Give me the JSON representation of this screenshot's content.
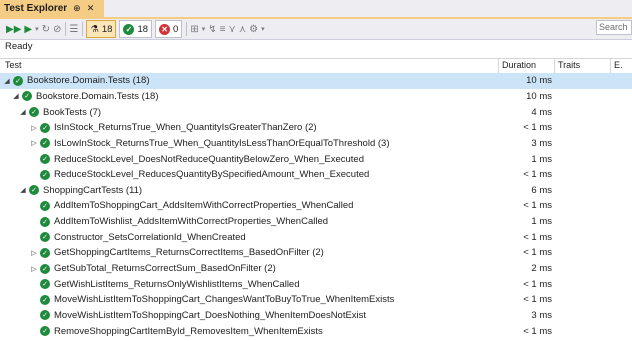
{
  "window": {
    "tab_title": "Test Explorer",
    "pin_glyph": "⊕",
    "close_glyph": "✕"
  },
  "toolbar": {
    "total_count": "18",
    "passed_count": "18",
    "failed_count": "0",
    "search_placeholder": "Search"
  },
  "status": {
    "text": "Ready"
  },
  "columns": {
    "test": "Test",
    "duration": "Duration",
    "traits": "Traits",
    "error": "E."
  },
  "colors": {
    "accent": "#f5cc84",
    "pass": "#1e8a3c",
    "fail": "#d13438",
    "selected_row": "#cce4f7"
  },
  "tree": [
    {
      "indent": 0,
      "expand": "expanded",
      "name": "Bookstore.Domain.Tests (18)",
      "duration": "10 ms",
      "selected": true
    },
    {
      "indent": 1,
      "expand": "expanded",
      "name": "Bookstore.Domain.Tests (18)",
      "duration": "10 ms"
    },
    {
      "indent": 2,
      "expand": "expanded",
      "name": "BookTests (7)",
      "duration": "4 ms"
    },
    {
      "indent": 3,
      "expand": "collapsed",
      "name": "IsInStock_ReturnsTrue_When_QuantityIsGreaterThanZero (2)",
      "duration": "< 1 ms"
    },
    {
      "indent": 3,
      "expand": "collapsed",
      "name": "IsLowInStock_ReturnsTrue_When_QuantityIsLessThanOrEqualToThreshold (3)",
      "duration": "3 ms"
    },
    {
      "indent": 3,
      "expand": "none",
      "name": "ReduceStockLevel_DoesNotReduceQuantityBelowZero_When_Executed",
      "duration": "1 ms"
    },
    {
      "indent": 3,
      "expand": "none",
      "name": "ReduceStockLevel_ReducesQuantityBySpecifiedAmount_When_Executed",
      "duration": "< 1 ms"
    },
    {
      "indent": 2,
      "expand": "expanded",
      "name": "ShoppingCartTests (11)",
      "duration": "6 ms"
    },
    {
      "indent": 3,
      "expand": "none",
      "name": "AddItemToShoppingCart_AddsItemWithCorrectProperties_WhenCalled",
      "duration": "< 1 ms"
    },
    {
      "indent": 3,
      "expand": "none",
      "name": "AddItemToWishlist_AddsItemWithCorrectProperties_WhenCalled",
      "duration": "1 ms"
    },
    {
      "indent": 3,
      "expand": "none",
      "name": "Constructor_SetsCorrelationId_WhenCreated",
      "duration": "< 1 ms"
    },
    {
      "indent": 3,
      "expand": "collapsed",
      "name": "GetShoppingCartItems_ReturnsCorrectItems_BasedOnFilter (2)",
      "duration": "< 1 ms"
    },
    {
      "indent": 3,
      "expand": "collapsed",
      "name": "GetSubTotal_ReturnsCorrectSum_BasedOnFilter (2)",
      "duration": "2 ms"
    },
    {
      "indent": 3,
      "expand": "none",
      "name": "GetWishListItems_ReturnsOnlyWishlistItems_WhenCalled",
      "duration": "< 1 ms"
    },
    {
      "indent": 3,
      "expand": "none",
      "name": "MoveWishListItemToShoppingCart_ChangesWantToBuyToTrue_WhenItemExists",
      "duration": "< 1 ms"
    },
    {
      "indent": 3,
      "expand": "none",
      "name": "MoveWishListItemToShoppingCart_DoesNothing_WhenItemDoesNotExist",
      "duration": "3 ms"
    },
    {
      "indent": 3,
      "expand": "none",
      "name": "RemoveShoppingCartItemById_RemovesItem_WhenItemExists",
      "duration": "< 1 ms"
    }
  ]
}
